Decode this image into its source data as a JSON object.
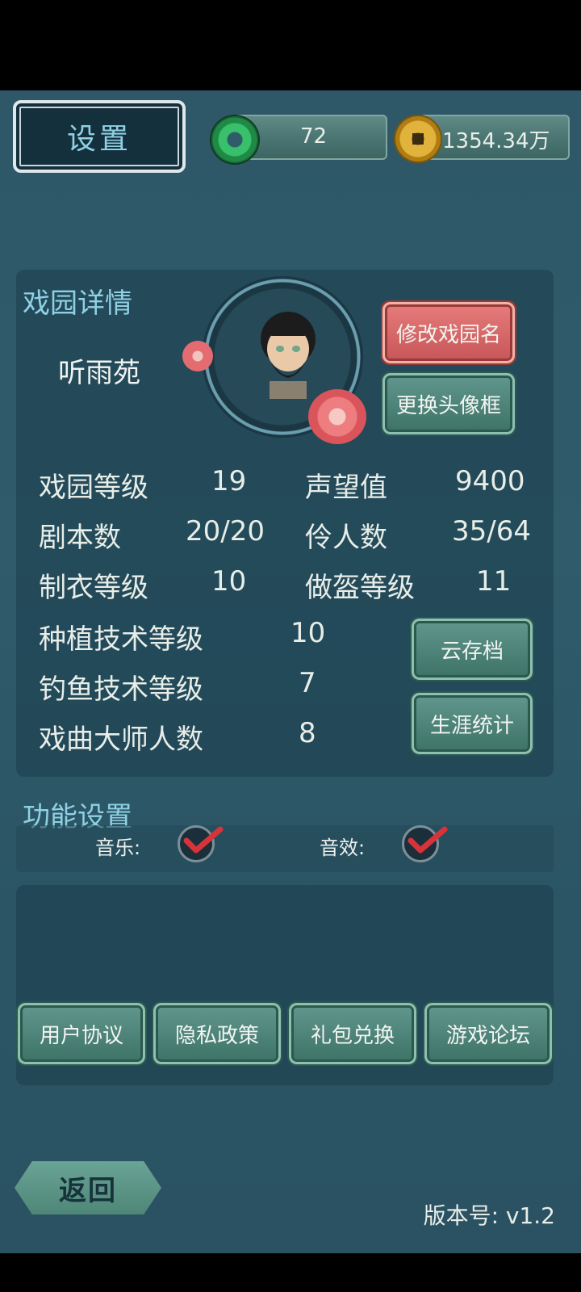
{
  "header": {
    "title": "设置",
    "jade_value": "72",
    "coin_value": "1354.34万"
  },
  "garden": {
    "section_title": "戏园详情",
    "name": "听雨苑",
    "rename_button": "修改戏园名",
    "change_frame_button": "更换头像框",
    "cloud_save_button": "云存档",
    "career_stats_button": "生涯统计",
    "stats": [
      {
        "label": "戏园等级",
        "value": "19"
      },
      {
        "label": "声望值",
        "value": "9400"
      },
      {
        "label": "剧本数",
        "value": "20/20"
      },
      {
        "label": "伶人数",
        "value": "35/64"
      },
      {
        "label": "制衣等级",
        "value": "10"
      },
      {
        "label": "做盔等级",
        "value": "11"
      },
      {
        "label": "种植技术等级",
        "value": "10"
      },
      {
        "label": "钓鱼技术等级",
        "value": "7"
      },
      {
        "label": "戏曲大师人数",
        "value": "8"
      }
    ]
  },
  "function_settings": {
    "section_title": "功能设置",
    "music_label": "音乐:",
    "music_enabled": true,
    "sfx_label": "音效:",
    "sfx_enabled": true
  },
  "links": {
    "user_agreement": "用户协议",
    "privacy_policy": "隐私政策",
    "gift_redeem": "礼包兑换",
    "game_forum": "游戏论坛"
  },
  "footer": {
    "back_button": "返回",
    "version": "版本号: v1.2"
  },
  "colors": {
    "accent_cyan": "#8fd0e3",
    "button_green": "#4f8478",
    "button_red": "#d4666a",
    "check_red": "#d8333a"
  }
}
